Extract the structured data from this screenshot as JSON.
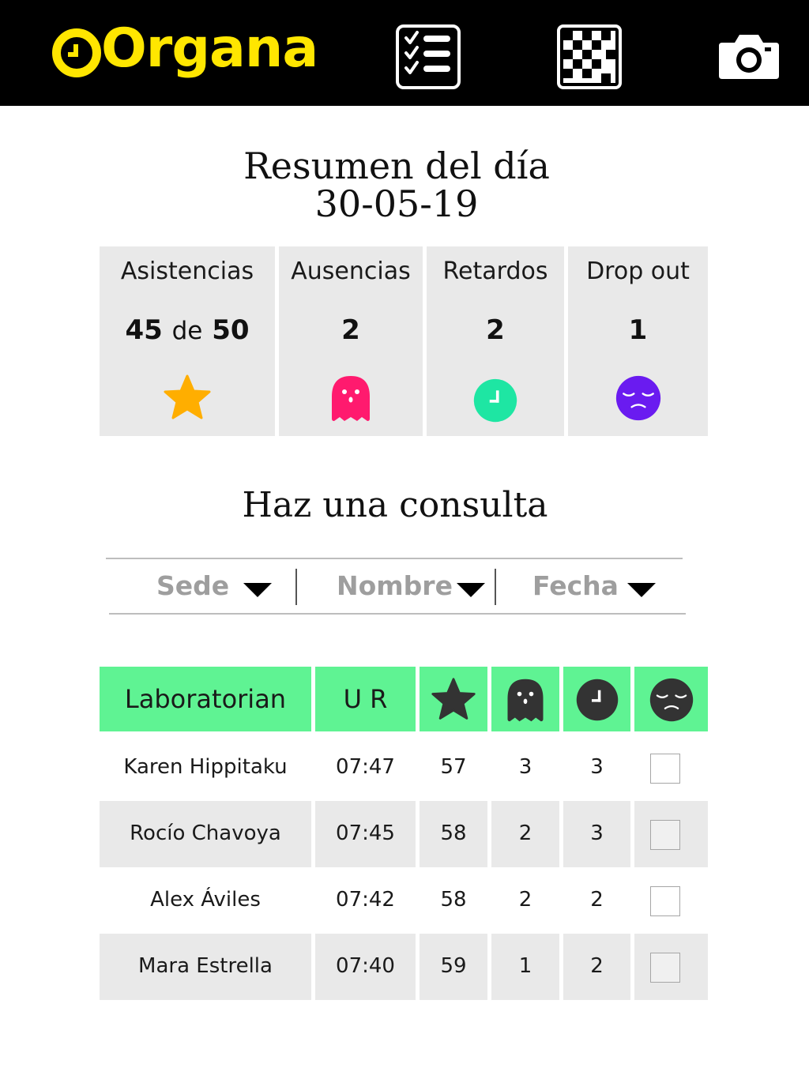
{
  "app": {
    "name": "Organa"
  },
  "nav": {
    "checklist_icon": "checklist-icon",
    "qr_icon": "qr-code-icon",
    "camera_icon": "camera-icon"
  },
  "summary": {
    "title": "Resumen del día",
    "date": "30-05-19",
    "cards": [
      {
        "label": "Asistencias",
        "value": "45",
        "connector": "de",
        "total": "50",
        "icon": "star-icon",
        "color": "#ffae00"
      },
      {
        "label": "Ausencias",
        "value": "2",
        "icon": "ghost-icon",
        "color": "#ff1a6e"
      },
      {
        "label": "Retardos",
        "value": "2",
        "icon": "clock-icon",
        "color": "#1ee6a3"
      },
      {
        "label": "Drop out",
        "value": "1",
        "icon": "sad-face-icon",
        "color": "#6a1bf0"
      }
    ]
  },
  "query": {
    "title": "Haz una consulta",
    "filters": [
      {
        "label": "Sede"
      },
      {
        "label": "Nombre"
      },
      {
        "label": "Fecha"
      }
    ]
  },
  "table": {
    "header_color": "#5ff393",
    "columns": [
      "Laboratorian",
      "U R"
    ],
    "icon_columns": [
      "star-icon",
      "ghost-icon",
      "clock-icon",
      "sad-face-icon"
    ],
    "rows": [
      {
        "name": "Karen Hippitaku",
        "ur": "07:47",
        "stars": "57",
        "absences": "3",
        "delays": "3",
        "dropout": false
      },
      {
        "name": "Rocío Chavoya",
        "ur": "07:45",
        "stars": "58",
        "absences": "2",
        "delays": "3",
        "dropout": false
      },
      {
        "name": "Alex Áviles",
        "ur": "07:42",
        "stars": "58",
        "absences": "2",
        "delays": "2",
        "dropout": false
      },
      {
        "name": "Mara Estrella",
        "ur": "07:40",
        "stars": "59",
        "absences": "1",
        "delays": "2",
        "dropout": false
      }
    ]
  }
}
